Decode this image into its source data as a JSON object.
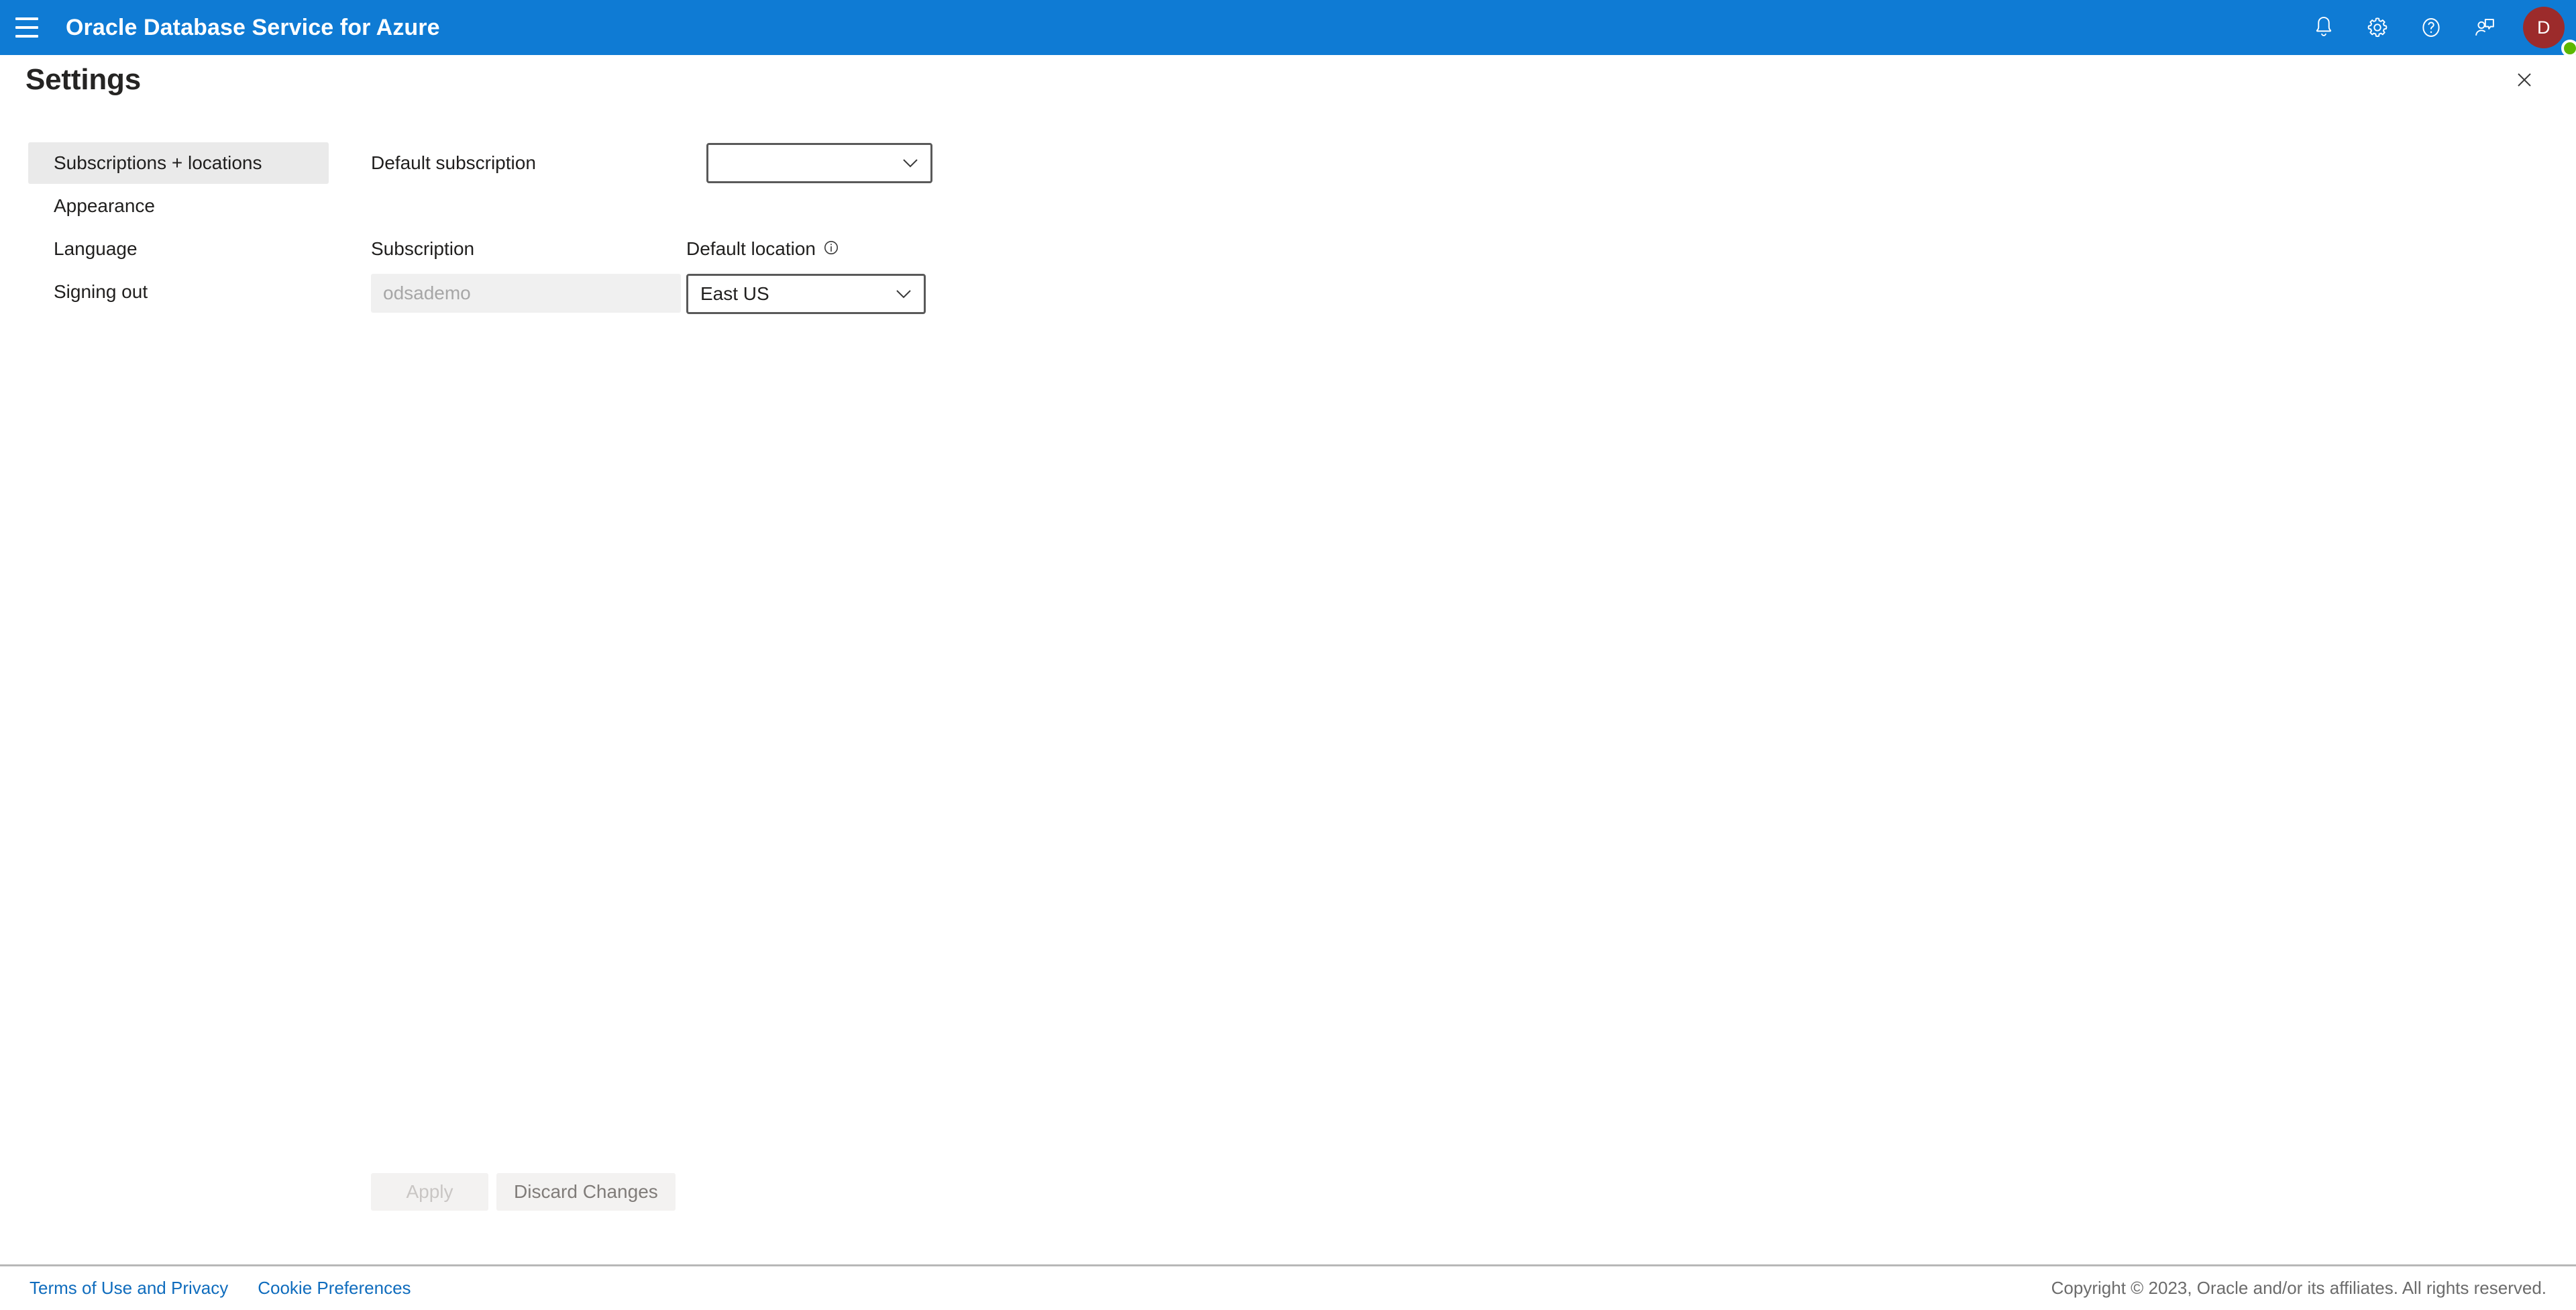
{
  "appbar": {
    "menu_icon": "hamburger-menu-icon",
    "title": "Oracle Database Service for Azure",
    "icons": [
      {
        "name": "notifications-icon",
        "label": "Notifications"
      },
      {
        "name": "settings-gear-icon",
        "label": "Settings"
      },
      {
        "name": "help-icon",
        "label": "Help"
      },
      {
        "name": "feedback-icon",
        "label": "Feedback"
      }
    ],
    "avatar": {
      "initial": "D",
      "presence": "available",
      "presence_color": "#5cb800",
      "background_color": "#9c2b2b"
    }
  },
  "panel": {
    "title": "Settings",
    "close_icon": "close-icon"
  },
  "sidebar": {
    "items": [
      {
        "label": "Subscriptions + locations",
        "selected": true
      },
      {
        "label": "Appearance",
        "selected": false
      },
      {
        "label": "Language",
        "selected": false
      },
      {
        "label": "Signing out",
        "selected": false
      }
    ]
  },
  "form": {
    "default_subscription": {
      "label": "Default subscription",
      "value": "",
      "placeholder": ""
    },
    "subscription": {
      "label": "Subscription",
      "value": "odsademo",
      "disabled": true
    },
    "default_location": {
      "label": "Default location",
      "info_icon": "info-icon",
      "value": "East US"
    }
  },
  "actions": {
    "apply_label": "Apply",
    "apply_disabled": true,
    "discard_label": "Discard Changes"
  },
  "footer": {
    "links": [
      {
        "label": "Terms of Use and Privacy"
      },
      {
        "label": "Cookie Preferences"
      }
    ],
    "copyright": "Copyright © 2023, Oracle and/or its affiliates. All rights reserved."
  },
  "colors": {
    "brand_blue": "#0f7bd4",
    "link_blue": "#0f6cbd",
    "selected_bg": "#eaeaea",
    "disabled_input_bg": "#f0f0f0",
    "button_bg": "#f3f2f1"
  }
}
